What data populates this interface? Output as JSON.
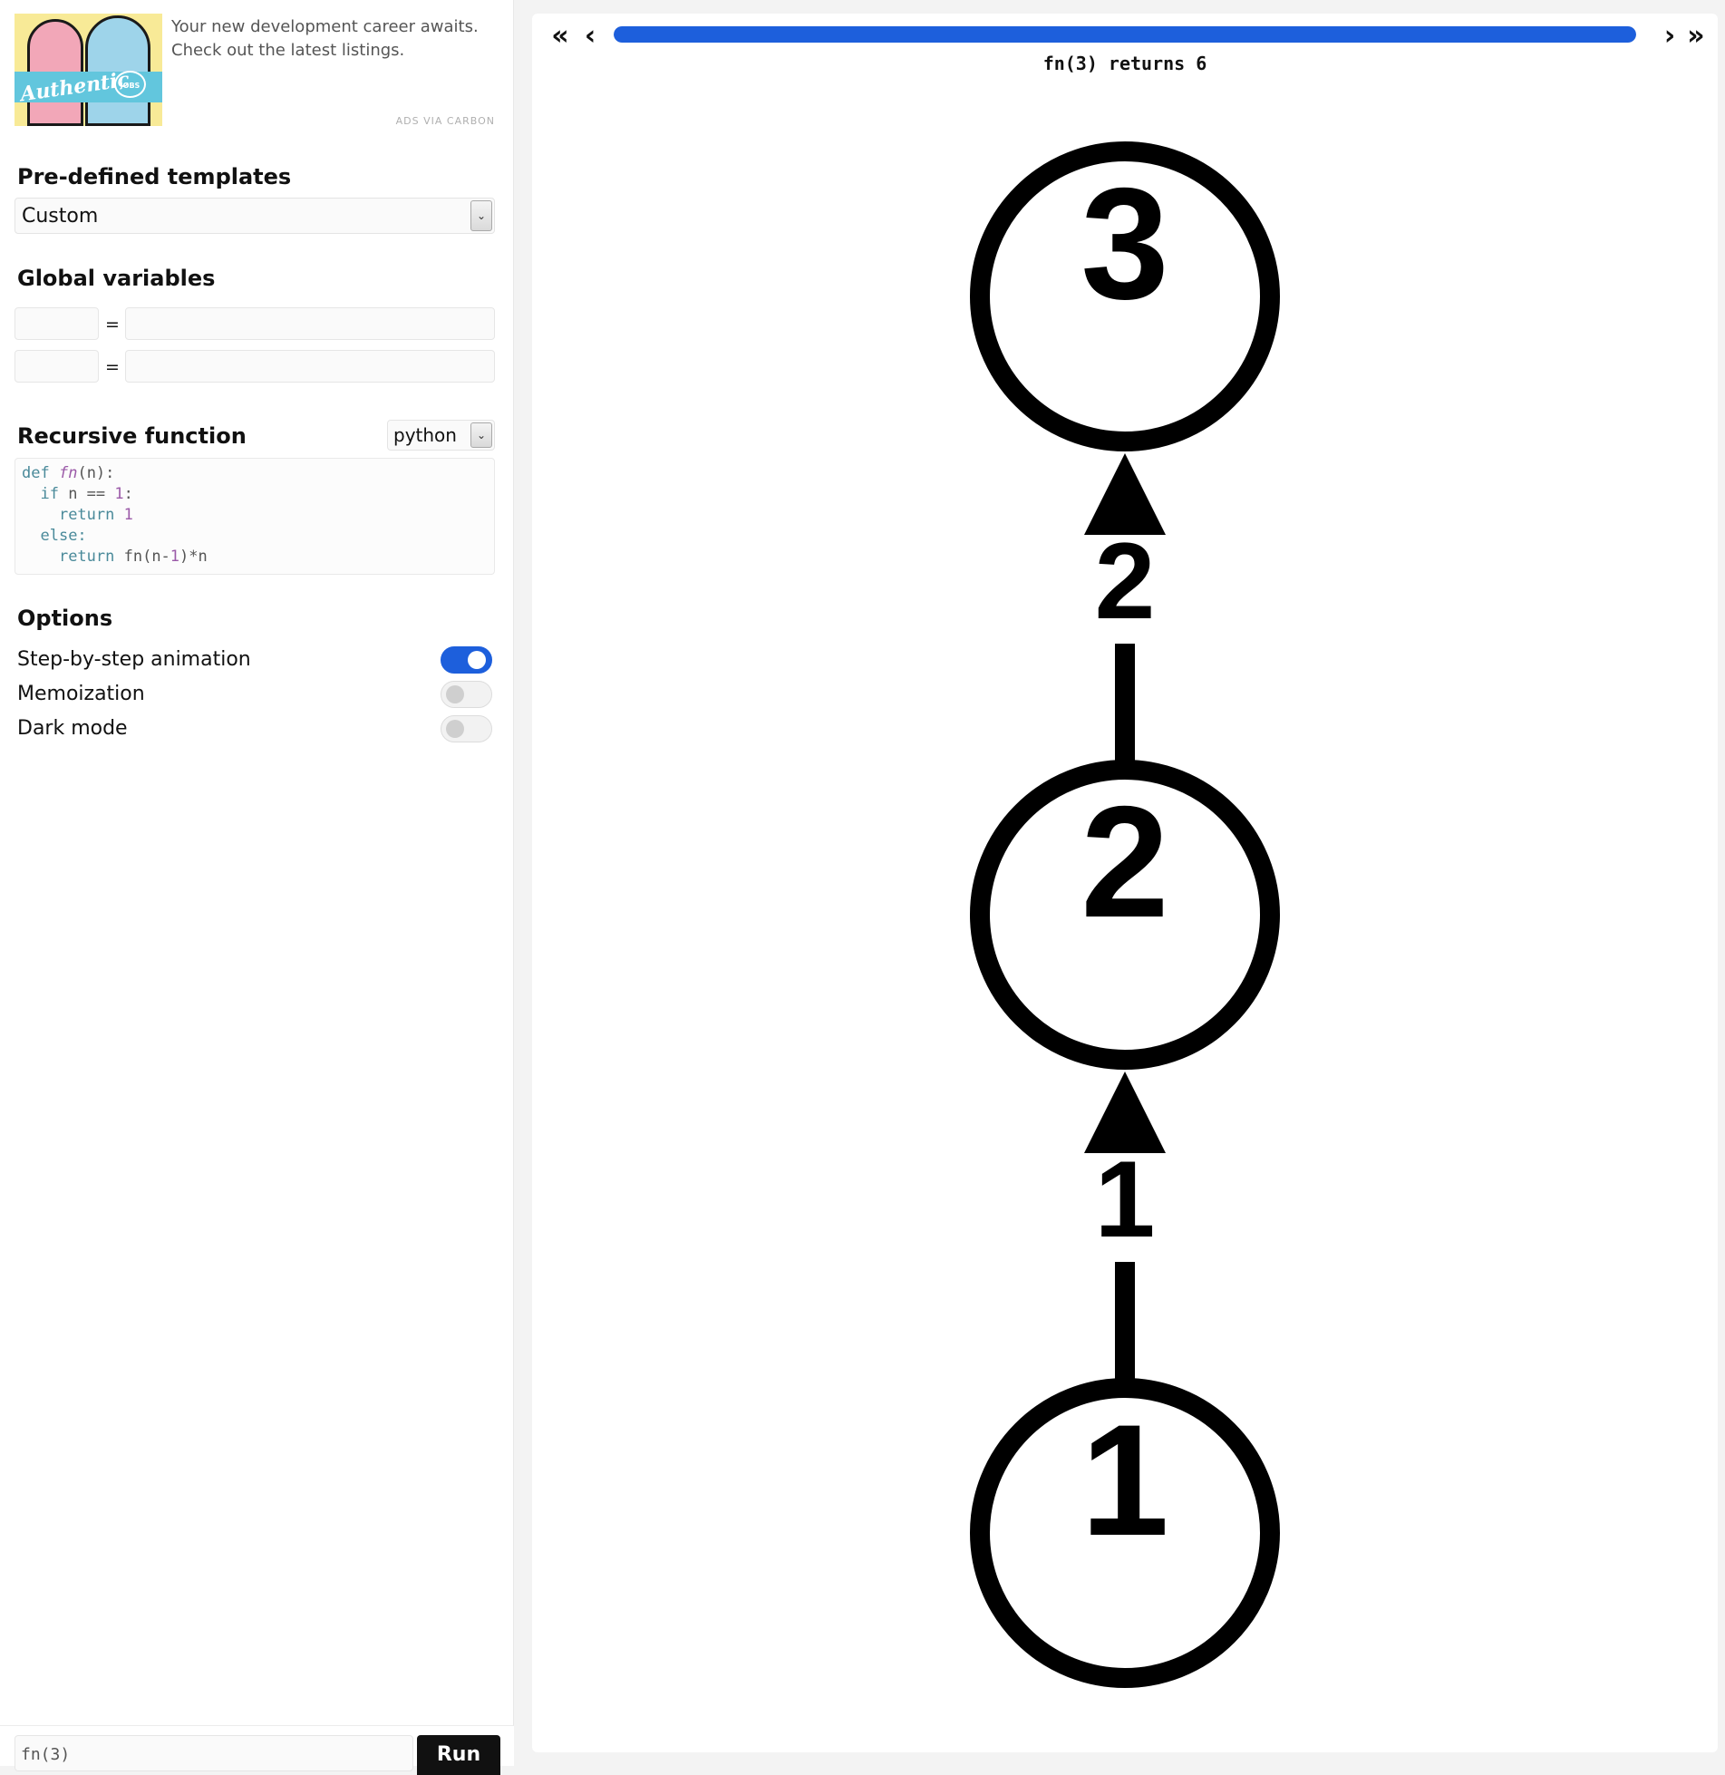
{
  "ad": {
    "image_script": "Authentic",
    "image_badge": "JOBS",
    "text_line1": "Your new development career awaits.",
    "text_line2": "Check out the latest listings.",
    "via": "ADS VIA CARBON"
  },
  "templates": {
    "title": "Pre-defined templates",
    "selected": "Custom"
  },
  "globals": {
    "title": "Global variables",
    "rows": [
      {
        "name": "",
        "eq": "=",
        "value": ""
      },
      {
        "name": "",
        "eq": "=",
        "value": ""
      }
    ]
  },
  "function": {
    "title": "Recursive function",
    "language": "python",
    "code": {
      "l1_kw": "def",
      "l1_name": "fn",
      "l1_rest": "(n):",
      "l2_kw": "if",
      "l2_mid": " n == ",
      "l2_num": "1",
      "l2_end": ":",
      "l3_kw": "return",
      "l3_num": "1",
      "l4_kw": "else:",
      "l5_kw": "return",
      "l5_mid": " fn(n-",
      "l5_num": "1",
      "l5_end": ")*n"
    }
  },
  "options": {
    "title": "Options",
    "items": [
      {
        "label": "Step-by-step animation",
        "on": true
      },
      {
        "label": "Memoization",
        "on": false
      },
      {
        "label": "Dark mode",
        "on": false
      }
    ]
  },
  "call": {
    "value": "fn(3)",
    "run_label": "Run"
  },
  "viewer": {
    "nav": {
      "first": "«",
      "prev": "‹",
      "next": "›",
      "last": "»"
    },
    "progress": 1.0,
    "result": "fn(3) returns 6",
    "tree": {
      "nodes": [
        "3",
        "2",
        "1"
      ],
      "edges": [
        {
          "from": "2",
          "to": "3",
          "label": "2"
        },
        {
          "from": "1",
          "to": "2",
          "label": "1"
        }
      ]
    }
  },
  "colors": {
    "accent": "#1d5fdc"
  }
}
